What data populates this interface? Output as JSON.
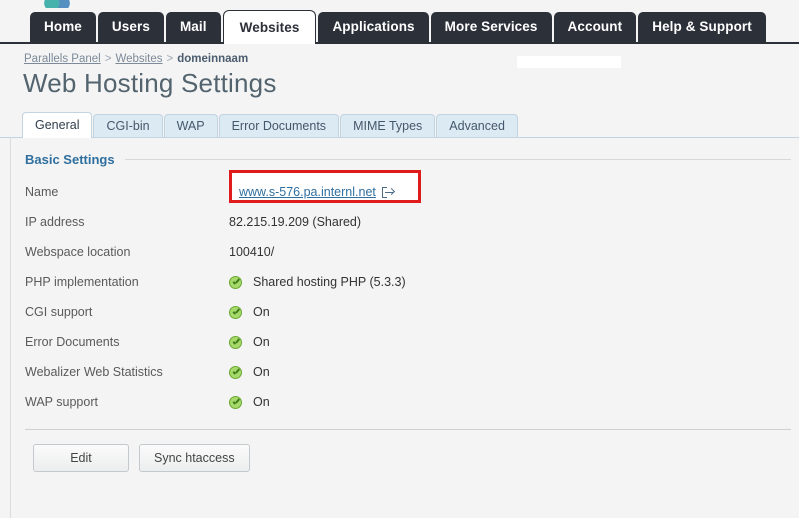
{
  "topnav": {
    "items": [
      {
        "label": "Home",
        "active": false
      },
      {
        "label": "Users",
        "active": false
      },
      {
        "label": "Mail",
        "active": false
      },
      {
        "label": "Websites",
        "active": true
      },
      {
        "label": "Applications",
        "active": false
      },
      {
        "label": "More Services",
        "active": false
      },
      {
        "label": "Account",
        "active": false
      },
      {
        "label": "Help & Support",
        "active": false
      }
    ]
  },
  "breadcrumb": {
    "root": "Parallels Panel",
    "sep": ">",
    "second": "Websites",
    "current": "domeinnaam"
  },
  "page": {
    "title": "Web Hosting Settings"
  },
  "subtabs": {
    "items": [
      {
        "label": "General",
        "active": true
      },
      {
        "label": "CGI-bin",
        "active": false
      },
      {
        "label": "WAP",
        "active": false
      },
      {
        "label": "Error Documents",
        "active": false
      },
      {
        "label": "MIME Types",
        "active": false
      },
      {
        "label": "Advanced",
        "active": false
      }
    ]
  },
  "section": {
    "title": "Basic Settings"
  },
  "settings": {
    "rows": [
      {
        "key": "Name",
        "value": "www.s-576.pa.internl.net",
        "type": "link",
        "highlighted": true,
        "icon": "external-link-icon"
      },
      {
        "key": "IP address",
        "value": "82.215.19.209 (Shared)",
        "type": "text",
        "highlighted": false
      },
      {
        "key": "Webspace location",
        "value": "100410/",
        "type": "text",
        "highlighted": false
      },
      {
        "key": "PHP implementation",
        "value": "Shared hosting PHP (5.3.3)",
        "type": "status",
        "highlighted": false
      },
      {
        "key": "CGI support",
        "value": "On",
        "type": "status",
        "highlighted": false
      },
      {
        "key": "Error Documents",
        "value": "On",
        "type": "status",
        "highlighted": false
      },
      {
        "key": "Webalizer Web Statistics",
        "value": "On",
        "type": "status",
        "highlighted": false
      },
      {
        "key": "WAP support",
        "value": "On",
        "type": "status",
        "highlighted": false
      }
    ]
  },
  "footer": {
    "buttons": [
      {
        "label": "Edit"
      },
      {
        "label": "Sync htaccess"
      }
    ]
  },
  "colors": {
    "nav_dark": "#2b3039",
    "accent_blue": "#2f6f9f",
    "highlight_red": "#e01b1b",
    "status_green": "#a6d96a"
  }
}
